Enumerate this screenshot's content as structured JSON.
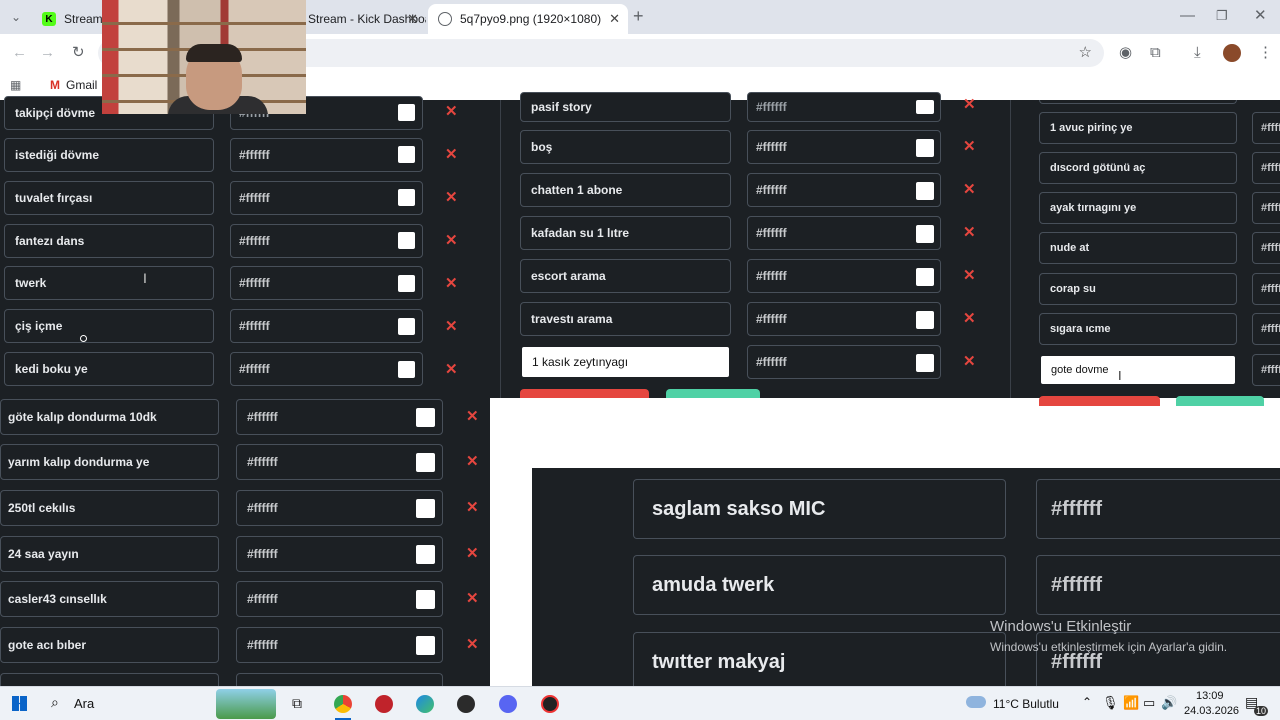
{
  "browser": {
    "tabs": [
      {
        "title": "Stream - K",
        "active": false
      },
      {
        "title": "Stream - Kick Dashboa",
        "active": false
      },
      {
        "title": "5q7pyo9.png (1920×1080)",
        "active": true
      }
    ],
    "url_fragment": "g",
    "bookmarks": [
      {
        "label": "Gmail"
      }
    ]
  },
  "panel1": {
    "rows": [
      {
        "label": "takipçi dövme",
        "color": "#ffffff"
      },
      {
        "label": "istediği dövme",
        "color": "#ffffff"
      },
      {
        "label": "tuvalet fırçası",
        "color": "#ffffff"
      },
      {
        "label": "fantezı dans",
        "color": "#ffffff"
      },
      {
        "label": "twerk",
        "color": "#ffffff"
      },
      {
        "label": "çiş içme",
        "color": "#ffffff"
      },
      {
        "label": "kedi boku ye",
        "color": "#ffffff"
      }
    ]
  },
  "panel2": {
    "rows": [
      {
        "label": "pasif story",
        "color": "#ffffff"
      },
      {
        "label": "boş",
        "color": "#ffffff"
      },
      {
        "label": "chatten 1 abone",
        "color": "#ffffff"
      },
      {
        "label": "kafadan su 1 lıtre",
        "color": "#ffffff"
      },
      {
        "label": "escort arama",
        "color": "#ffffff"
      },
      {
        "label": "travestı arama",
        "color": "#ffffff"
      },
      {
        "label": "1 kasık zeytınyagı",
        "color": "#ffffff",
        "active": true
      }
    ]
  },
  "panel3": {
    "rows": [
      {
        "label": "1 avuc pirinç ye",
        "color": "#ffffff"
      },
      {
        "label": "dıscord götünü aç",
        "color": "#ffffff"
      },
      {
        "label": "ayak tırnagını ye",
        "color": "#ffffff"
      },
      {
        "label": "nude at",
        "color": "#ffffff"
      },
      {
        "label": "corap su",
        "color": "#ffffff"
      },
      {
        "label": "sıgara ıcme",
        "color": "#ffffff"
      },
      {
        "label": "gote dovme",
        "color": "#ffffff",
        "active": true
      }
    ]
  },
  "panel4": {
    "rows": [
      {
        "label": "göte kalıp dondurma 10dk",
        "color": "#ffffff"
      },
      {
        "label": "yarım kalıp dondurma ye",
        "color": "#ffffff"
      },
      {
        "label": "250tl cekılıs",
        "color": "#ffffff"
      },
      {
        "label": "24 saa yayın",
        "color": "#ffffff"
      },
      {
        "label": "casler43 cınsellık",
        "color": "#ffffff"
      },
      {
        "label": "gote acı bıber",
        "color": "#ffffff"
      }
    ]
  },
  "panel5": {
    "rows": [
      {
        "label": "saglam sakso MIC",
        "color": "#ffffff"
      },
      {
        "label": "amuda twerk",
        "color": "#ffffff"
      },
      {
        "label": "twıtter makyaj",
        "color": "#ffffff"
      }
    ]
  },
  "watermark": {
    "title": "Windows'u Etkinleştir",
    "subtitle": "Windows'u etkinleştirmek için Ayarlar'a gidin."
  },
  "taskbar": {
    "search_label": "Ara",
    "weather": "11°C Bulutlu",
    "time": "13:09",
    "date": "24.03.2026",
    "notifications": "10"
  },
  "colors": {
    "panel_bg": "#1c2024",
    "delete": "#e5463f",
    "save_button": "#e5463f",
    "add_button": "#4fd1a5"
  }
}
